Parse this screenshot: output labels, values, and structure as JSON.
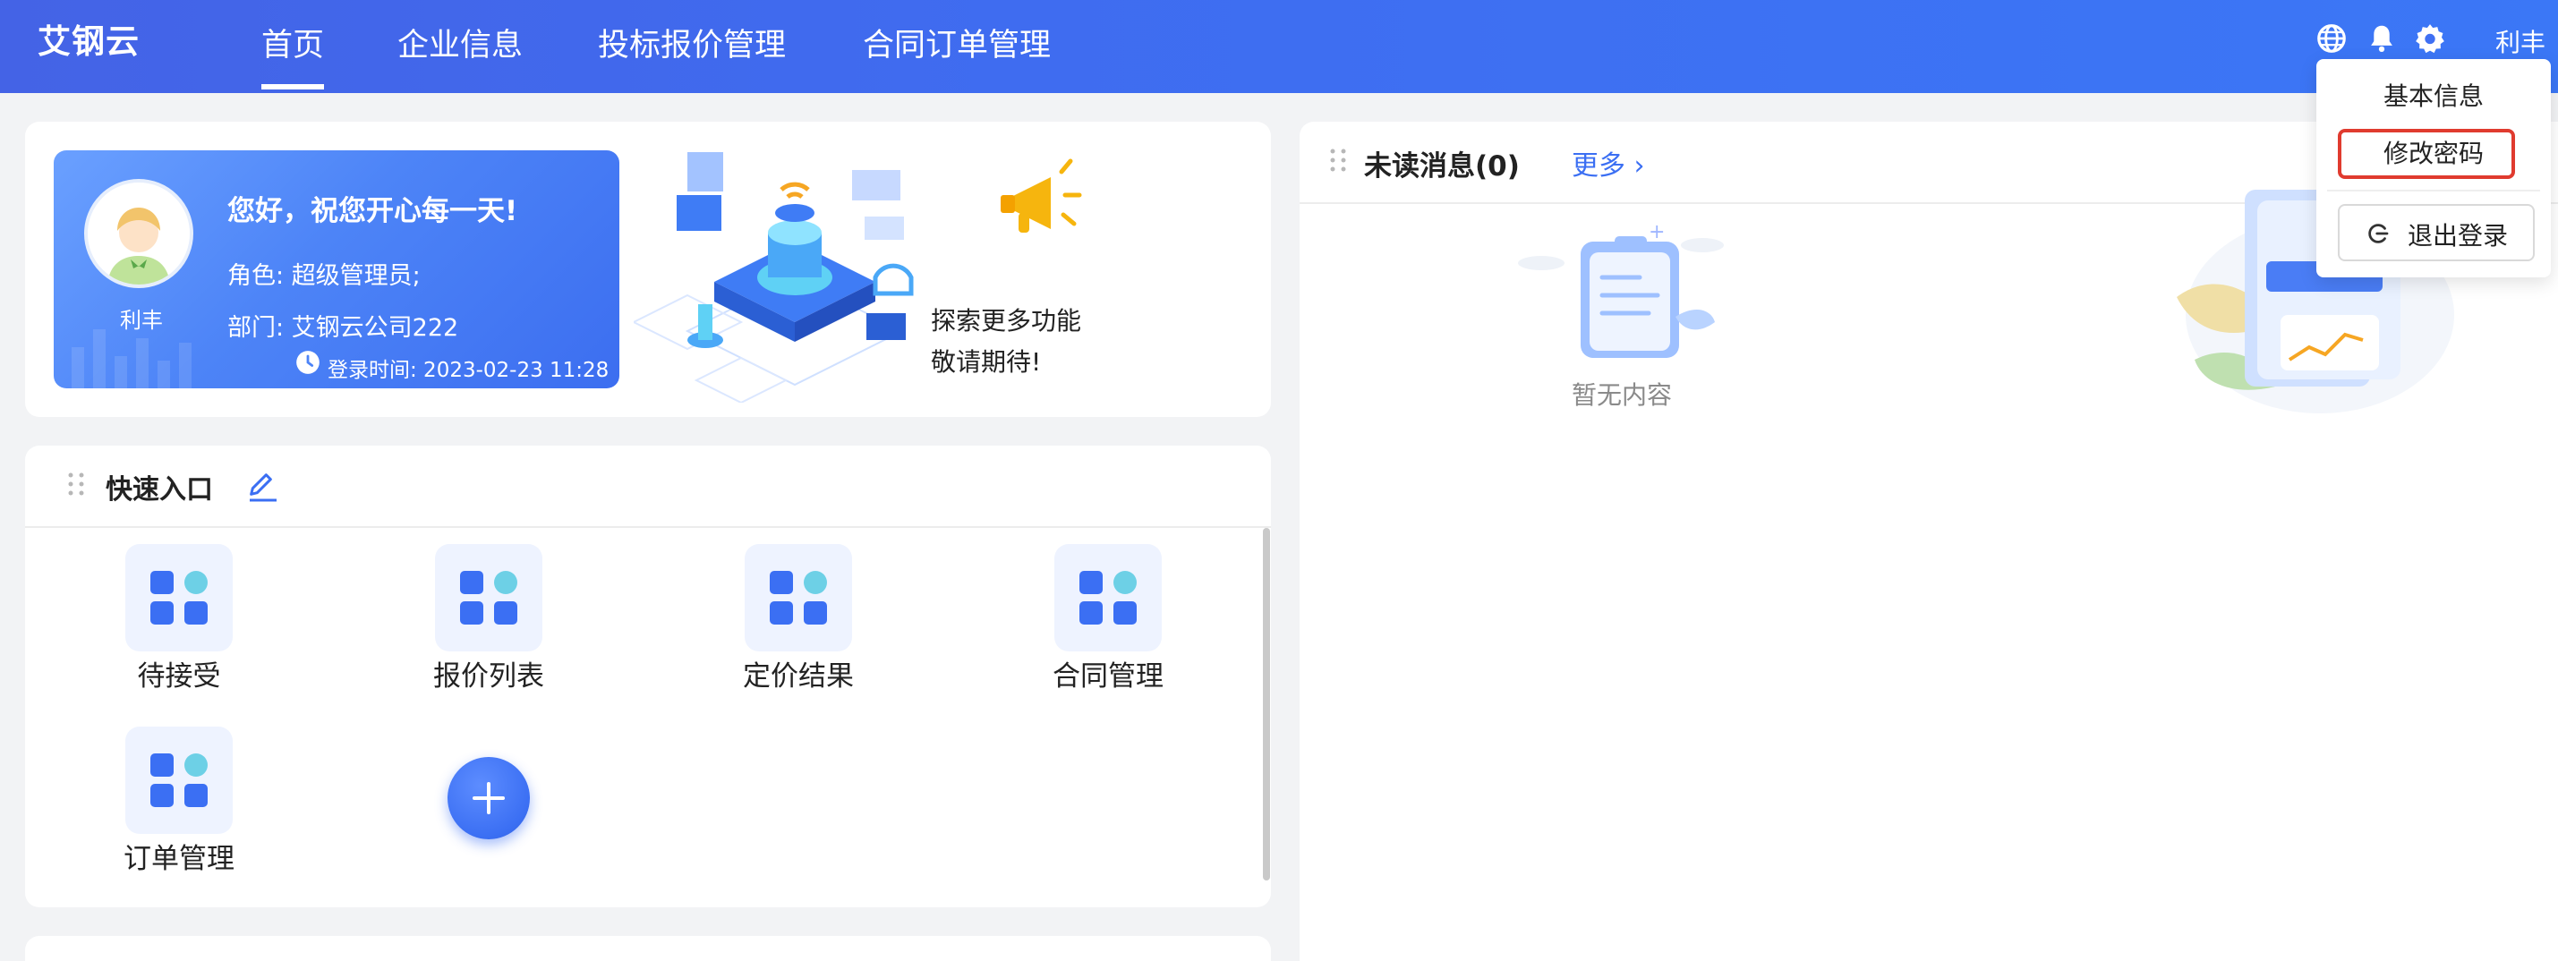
{
  "app": {
    "logo": "艾钢云"
  },
  "nav": {
    "items": [
      {
        "label": "首页",
        "active": true
      },
      {
        "label": "企业信息"
      },
      {
        "label": "投标报价管理"
      },
      {
        "label": "合同订单管理"
      }
    ]
  },
  "header": {
    "icons": [
      "globe-icon",
      "bell-icon",
      "gear-icon"
    ],
    "user_name": "利丰"
  },
  "user_menu": {
    "items": [
      {
        "label": "基本信息"
      },
      {
        "label": "修改密码",
        "highlighted": true
      }
    ],
    "logout_label": "退出登录"
  },
  "welcome": {
    "greeting": "您好，祝您开心每一天!",
    "role": "角色: 超级管理员;",
    "department": "部门: 艾钢云公司222",
    "login_time": "登录时间: 2023-02-23 11:28",
    "avatar_name": "利丰",
    "explore_line1": "探索更多功能",
    "explore_line2": "敬请期待!"
  },
  "quick_entry": {
    "title": "快速入口",
    "tiles": [
      {
        "label": "待接受"
      },
      {
        "label": "报价列表"
      },
      {
        "label": "定价结果"
      },
      {
        "label": "合同管理"
      },
      {
        "label": "订单管理"
      }
    ]
  },
  "messages": {
    "title": "未读消息(0)",
    "more": "更多",
    "empty": "暂无内容"
  },
  "colors": {
    "primary": "#3b6ff3",
    "nav_start": "#4463e6",
    "nav_end": "#3b77f6",
    "highlight_border": "#e03b2f"
  }
}
